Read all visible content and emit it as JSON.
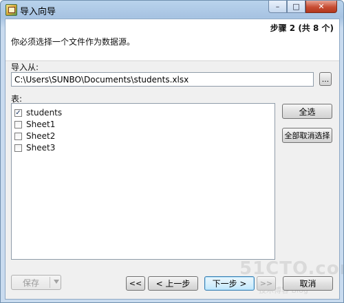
{
  "window": {
    "title": "导入向导",
    "minimize_glyph": "–",
    "maximize_glyph": "□",
    "close_glyph": "✕"
  },
  "header": {
    "step": "步骤 2 (共 8 个)",
    "instruction": "你必须选择一个文件作为数据源。"
  },
  "import": {
    "label": "导入从:",
    "path": "C:\\Users\\SUNBO\\Documents\\students.xlsx",
    "browse_label": "..."
  },
  "tables": {
    "label": "表:",
    "items": [
      {
        "name": "students",
        "checked": true
      },
      {
        "name": "Sheet1",
        "checked": false
      },
      {
        "name": "Sheet2",
        "checked": false
      },
      {
        "name": "Sheet3",
        "checked": false
      }
    ],
    "select_all": "全选",
    "deselect_all": "全部取消选择"
  },
  "footer": {
    "save": "保存",
    "first": "<<",
    "prev": "< 上一步",
    "next": "下一步 >",
    "last": ">>",
    "cancel": "取消"
  },
  "watermark": {
    "main": "51CTO.com",
    "sub": "技术博客 Blog"
  }
}
